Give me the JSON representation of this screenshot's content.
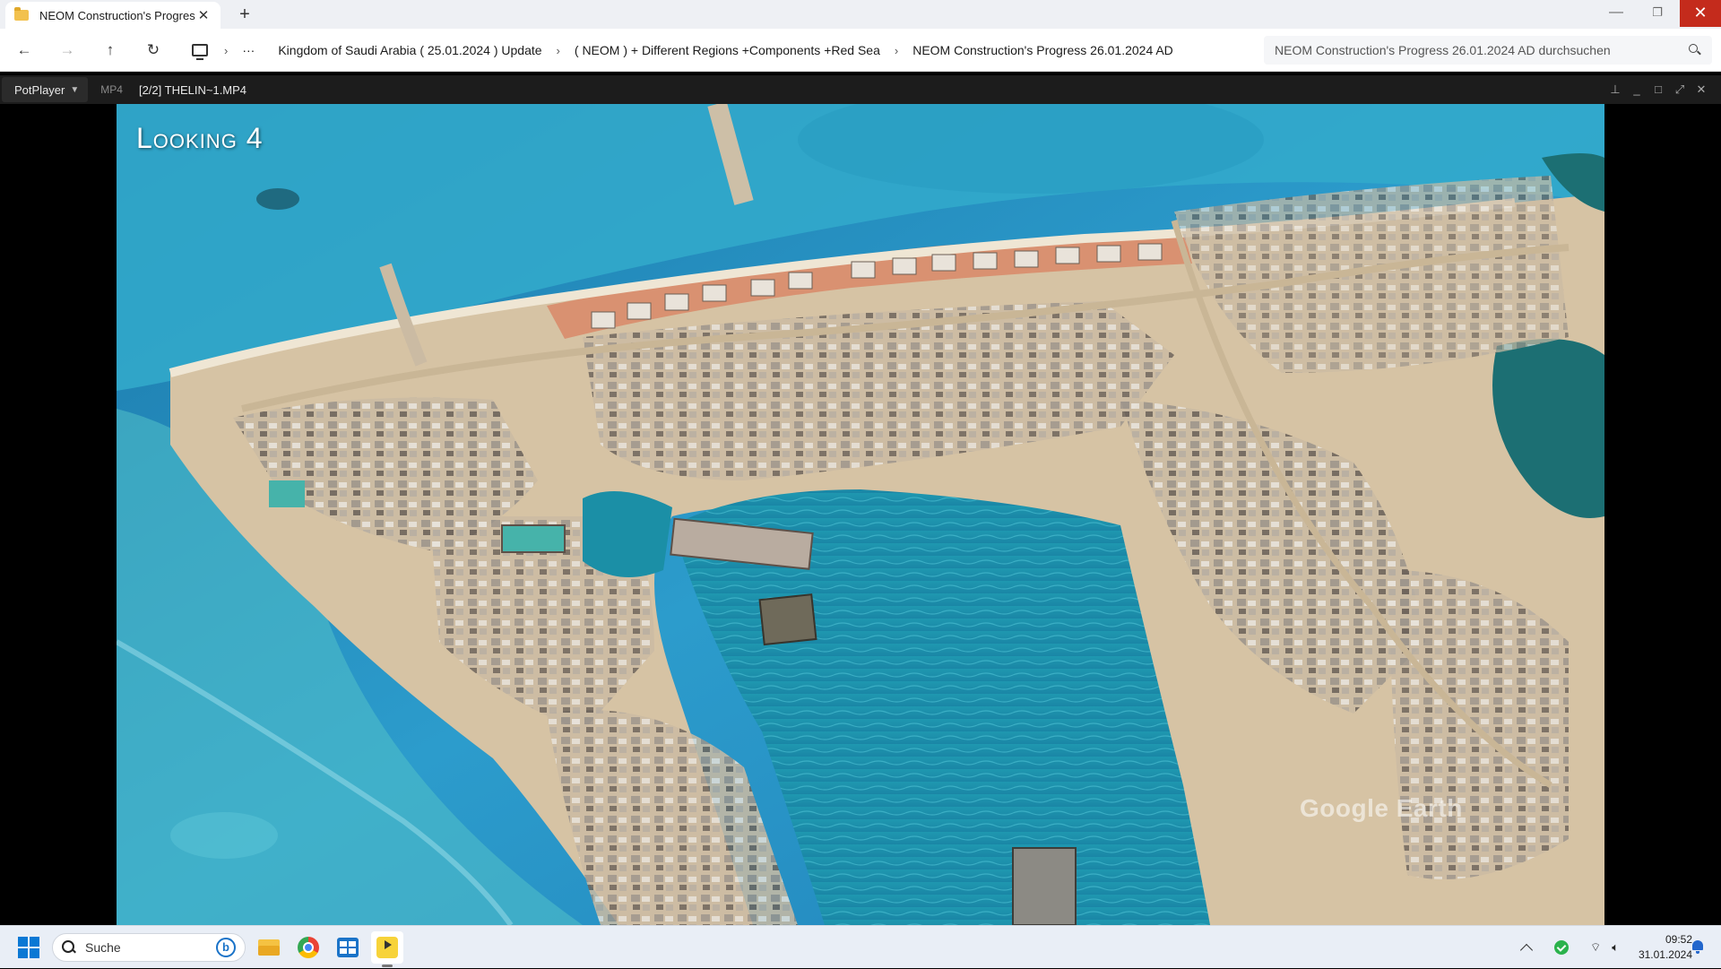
{
  "explorer": {
    "tab_title": "NEOM Construction's Progress",
    "breadcrumbs": [
      "Kingdom of Saudi Arabia ( 25.01.2024 ) Update",
      "( NEOM ) + Different Regions +Components +Red Sea",
      "NEOM Construction's Progress 26.01.2024 AD"
    ],
    "search_placeholder": "NEOM Construction's Progress 26.01.2024 AD durchsuchen"
  },
  "player": {
    "app_name": "PotPlayer",
    "format": "MP4",
    "file": "[2/2] THELIN~1.MP4",
    "overlay_title": "Looking 4",
    "watermark": "Google Earth"
  },
  "taskbar": {
    "search_label": "Suche",
    "time": "09:52",
    "date": "31.01.2024",
    "apps": [
      "file-explorer",
      "chrome",
      "microsoft-store",
      "potplayer"
    ]
  },
  "colors": {
    "close_red": "#c42b1c",
    "water_deep": "#1d7fb0",
    "water_shallow": "#3ab6cf",
    "sand": "#d8c3a2",
    "beach_orange": "#d9896a",
    "accent_blue": "#0a78d4"
  }
}
